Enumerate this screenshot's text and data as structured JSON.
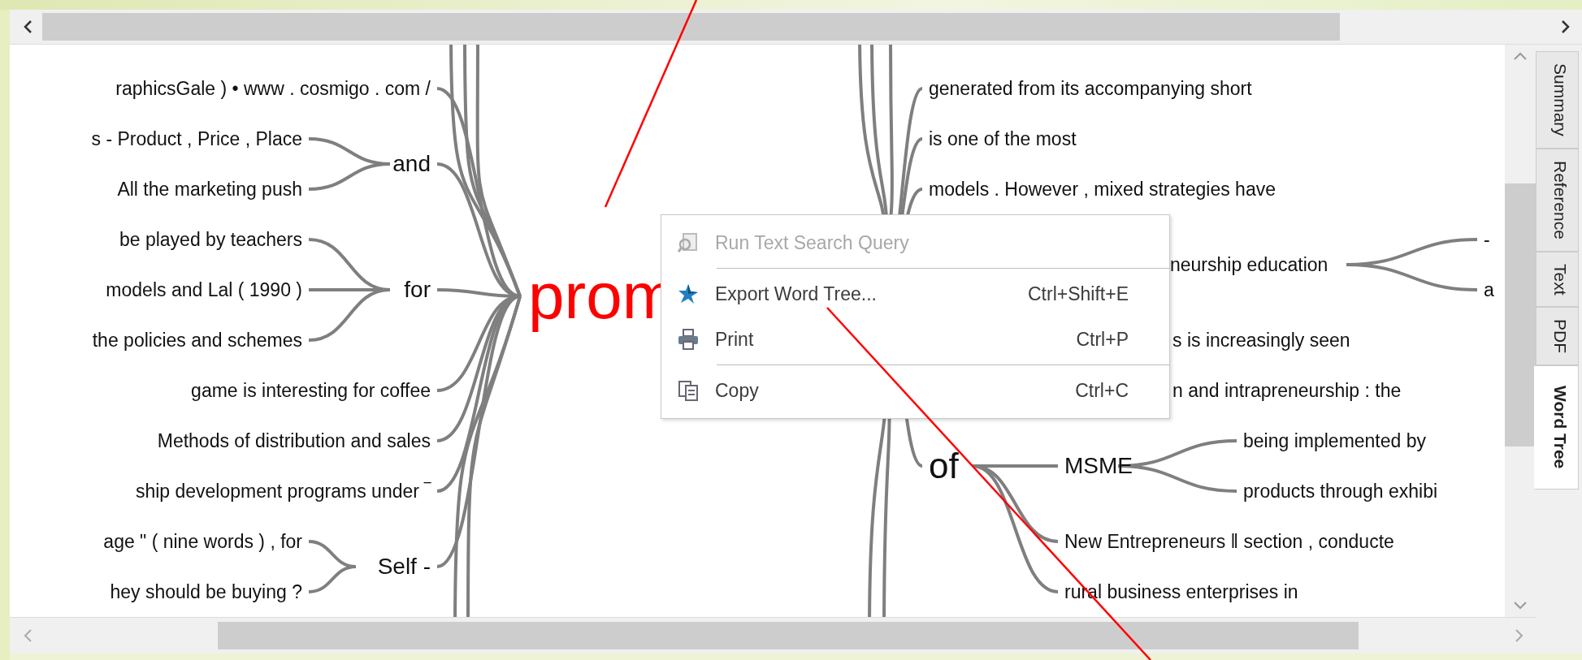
{
  "word_tree": {
    "root": "prom",
    "left": [
      {
        "text": "raphicsGale ) • www . cosmigo . com /"
      },
      {
        "text": "and",
        "children": [
          {
            "text": "s - Product , Price , Place"
          },
          {
            "text": "All the marketing push"
          }
        ]
      },
      {
        "text": "for",
        "children": [
          {
            "text": "be played by teachers"
          },
          {
            "text": "models and Lal ( 1990 )"
          },
          {
            "text": "the policies and schemes"
          }
        ]
      },
      {
        "text": "game is interesting for coffee"
      },
      {
        "text": "Methods of distribution and sales"
      },
      {
        "text": "ship development programs under ‾"
      },
      {
        "text": "Self -",
        "children": [
          {
            "text": "age \" ( nine words ) , for"
          },
          {
            "text": "hey should be buying ?"
          }
        ]
      }
    ],
    "right": [
      {
        "text": "generated from its accompanying short"
      },
      {
        "text": "is one of the most"
      },
      {
        "text": "models . However , mixed strategies have"
      },
      {
        "text": "neurship education",
        "children": [
          {
            "text": "-"
          },
          {
            "text": "a"
          }
        ]
      },
      {
        "text": "s is increasingly seen"
      },
      {
        "text": "n and intrapreneurship : the"
      },
      {
        "text": "of",
        "children": [
          {
            "text": "MSME",
            "children": [
              {
                "text": "being implemented by"
              },
              {
                "text": "products through exhibi"
              }
            ]
          },
          {
            "text": "New Entrepreneurs ‖ section , conducte"
          },
          {
            "text": "rural business enterprises in"
          }
        ]
      }
    ]
  },
  "context_menu": {
    "items": [
      {
        "kind": "item",
        "label": "Run Text Search Query",
        "disabled": true
      },
      {
        "kind": "separator"
      },
      {
        "kind": "item",
        "label": "Export Word Tree...",
        "shortcut": "Ctrl+Shift+E",
        "disabled": false
      },
      {
        "kind": "item",
        "label": "Print",
        "shortcut": "Ctrl+P",
        "disabled": false
      },
      {
        "kind": "separator"
      },
      {
        "kind": "item",
        "label": "Copy",
        "shortcut": "Ctrl+C",
        "disabled": false
      }
    ]
  },
  "side_tabs": [
    {
      "label": "Summary",
      "selected": false
    },
    {
      "label": "Reference",
      "selected": false
    },
    {
      "label": "Text",
      "selected": false
    },
    {
      "label": "PDF",
      "selected": false
    },
    {
      "label": "Word Tree",
      "selected": true
    }
  ]
}
